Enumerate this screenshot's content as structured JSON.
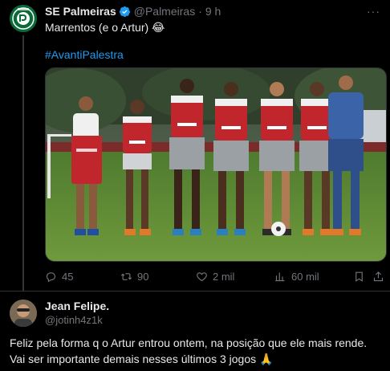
{
  "tweet": {
    "author_name": "SE Palmeiras",
    "author_handle": "@Palmeiras",
    "separator": "·",
    "time": "9 h",
    "more": "···",
    "text": "Marrentos (e o Artur) 😂",
    "hashtag": "#AvantiPalestra",
    "stats": {
      "replies": "45",
      "retweets": "90",
      "likes": "2 mil",
      "views": "60 mil"
    },
    "colors": {
      "verified": "#1d9bf0",
      "link": "#1d9bf0",
      "muted": "#71767b"
    }
  },
  "reply": {
    "author_name": "Jean Felipe.",
    "author_handle": "@jotinh4z1k",
    "text_line1": "Feliz pela forma q o Artur entrou ontem, na posição que ele mais rende.",
    "text_line2": "Vai ser importante demais nesses últimos 3 jogos 🙏"
  },
  "icons": {
    "avatar": "palmeiras-crest-icon",
    "verified": "verified-badge-icon",
    "reply": "reply-icon",
    "retweet": "retweet-icon",
    "like": "heart-icon",
    "views": "views-chart-icon",
    "bookmark": "bookmark-icon",
    "share": "share-icon"
  }
}
